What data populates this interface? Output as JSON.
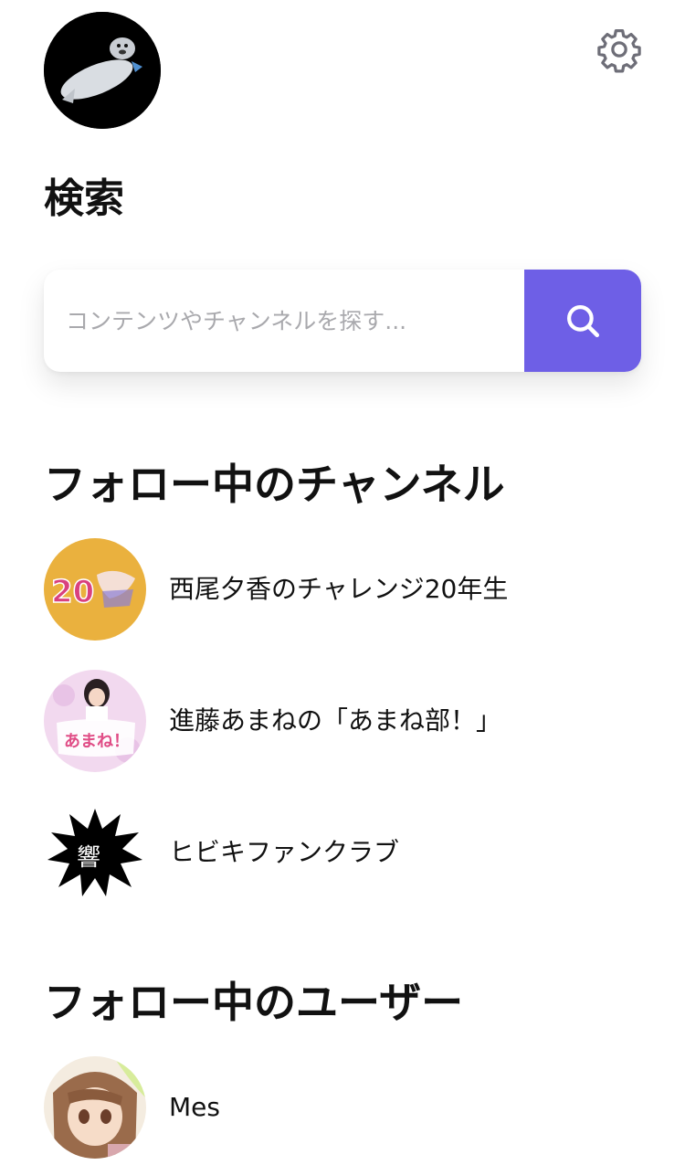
{
  "header": {
    "profile_icon": "user-avatar",
    "settings_icon": "gear-icon"
  },
  "page": {
    "title": "検索"
  },
  "search": {
    "placeholder": "コンテンツやチャンネルを探す...",
    "value": "",
    "button_icon": "search-icon",
    "accent_color": "#6e5fe6"
  },
  "followed_channels": {
    "title": "フォロー中のチャンネル",
    "items": [
      {
        "label": "西尾夕香のチャレンジ20年生",
        "thumb_text": "20",
        "thumb_color": "#eab13e"
      },
      {
        "label": "進藤あまねの「あまね部！」",
        "thumb_text": "あまね！",
        "thumb_color": "#f2d9ef"
      },
      {
        "label": "ヒビキファンクラブ",
        "thumb_text": "響",
        "thumb_color": "#000000"
      }
    ]
  },
  "followed_users": {
    "title": "フォロー中のユーザー",
    "items": [
      {
        "label": "Mes",
        "thumb_color": "#f4ece0"
      }
    ]
  }
}
